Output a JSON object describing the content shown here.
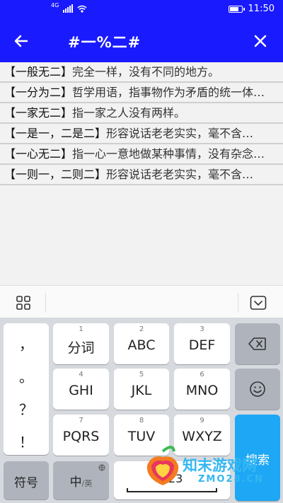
{
  "status_bar": {
    "network": "4G",
    "time": "11:50",
    "battery_level": 0.85
  },
  "header": {
    "title": "#一%二#"
  },
  "results": [
    {
      "word": "【一般无二】",
      "def": "完全一样，没有不同的地方。"
    },
    {
      "word": "【一分为二】",
      "def": "哲学用语，指事物作为矛盾的统一体…"
    },
    {
      "word": "【一家无二】",
      "def": "指一家之人没有两样。"
    },
    {
      "word": "【一是一，二是二】",
      "def": "形容说话老老实实，毫不含…"
    },
    {
      "word": "【一心无二】",
      "def": "指一心一意地做某种事情，没有杂念…"
    },
    {
      "word": "【一则一，二则二】",
      "def": "形容说话老老实实，毫不含…"
    }
  ],
  "keyboard": {
    "punctuation": [
      "，",
      "。",
      "？",
      "！"
    ],
    "keys": {
      "k1": {
        "num": "1",
        "label": "分词"
      },
      "k2": {
        "num": "2",
        "label": "ABC"
      },
      "k3": {
        "num": "3",
        "label": "DEF"
      },
      "k4": {
        "num": "4",
        "label": "GHI"
      },
      "k5": {
        "num": "5",
        "label": "JKL"
      },
      "k6": {
        "num": "6",
        "label": "MNO"
      },
      "k7": {
        "num": "7",
        "label": "PQRS"
      },
      "k8": {
        "num": "8",
        "label": "TUV"
      },
      "k9": {
        "num": "9",
        "label": "WXYZ"
      }
    },
    "symbols_label": "符号",
    "lang_label_main": "中",
    "lang_label_sub": "/英",
    "space_label": "123",
    "search_label": "搜索"
  },
  "watermark": {
    "text": "知末游戏网",
    "sub": "ZMO28.CN"
  },
  "colors": {
    "brand": "#1a1aff",
    "search": "#1ea7f5"
  },
  "icons": [
    "back-arrow-icon",
    "close-icon",
    "grid-icon",
    "keyboard-hide-icon",
    "backspace-icon",
    "emoji-icon",
    "globe-icon",
    "wifi-icon",
    "signal-icon",
    "battery-icon"
  ]
}
